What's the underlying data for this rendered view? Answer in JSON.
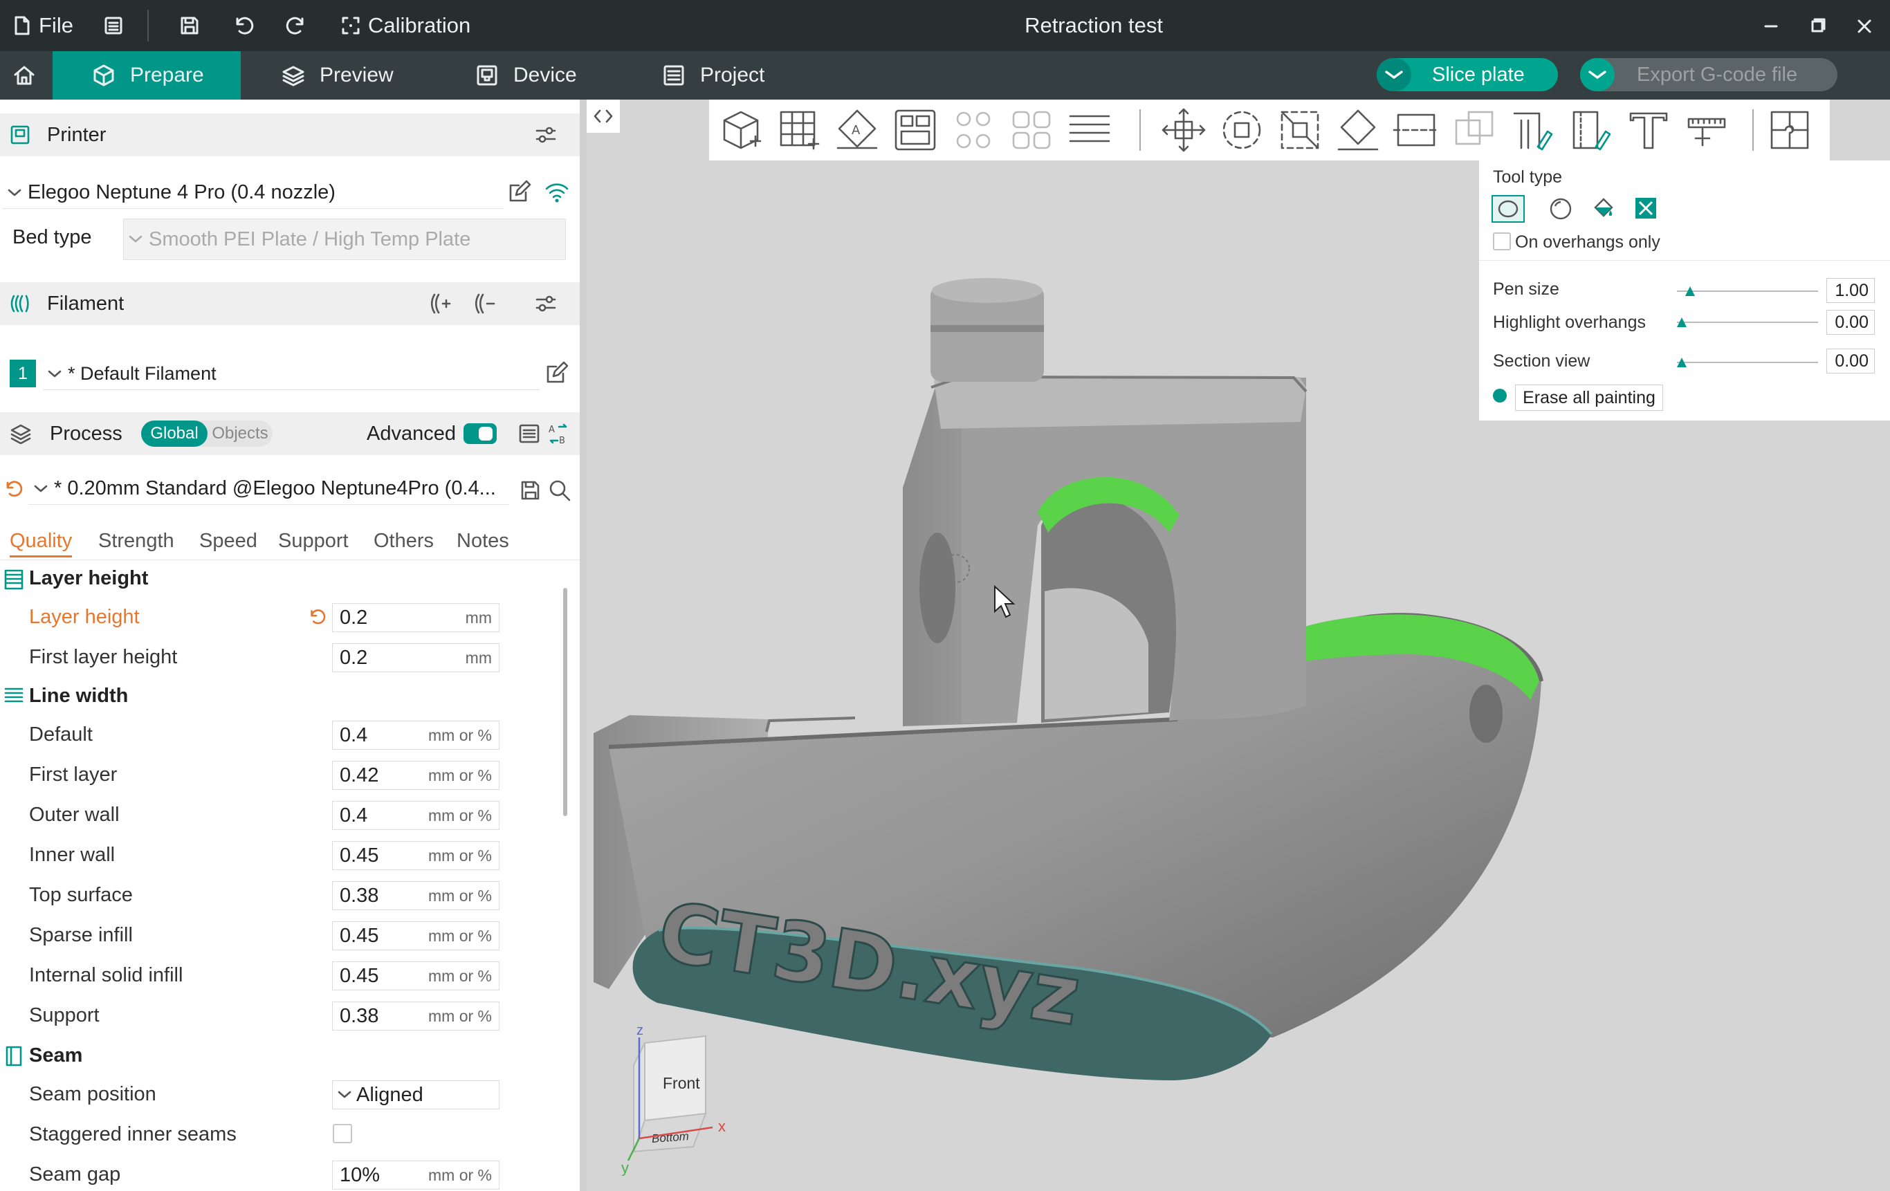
{
  "window": {
    "title": "Retraction test",
    "menu_file": "File",
    "menu_calibration": "Calibration"
  },
  "tabs": [
    {
      "label": "Prepare",
      "active": true
    },
    {
      "label": "Preview",
      "active": false
    },
    {
      "label": "Device",
      "active": false
    },
    {
      "label": "Project",
      "active": false
    }
  ],
  "actions": {
    "slice": "Slice plate",
    "export": "Export G-code file"
  },
  "printer": {
    "section_title": "Printer",
    "name": "Elegoo Neptune 4 Pro (0.4 nozzle)",
    "bed_type_label": "Bed type",
    "bed_type_value": "Smooth PEI Plate / High Temp Plate"
  },
  "filament": {
    "section_title": "Filament",
    "slot": "1",
    "name": "* Default Filament"
  },
  "process": {
    "section_title": "Process",
    "toggle_global": "Global",
    "toggle_objects": "Objects",
    "advanced_label": "Advanced",
    "advanced_on": true,
    "profile": "* 0.20mm Standard @Elegoo Neptune4Pro (0.4...",
    "subtabs": [
      "Quality",
      "Strength",
      "Speed",
      "Support",
      "Others",
      "Notes"
    ],
    "active_subtab": "Quality"
  },
  "quality": {
    "layer_height_group": "Layer height",
    "layer_height": {
      "label": "Layer height",
      "value": "0.2",
      "unit": "mm",
      "modified": true
    },
    "first_layer_height": {
      "label": "First layer height",
      "value": "0.2",
      "unit": "mm"
    },
    "line_width_group": "Line width",
    "line_widths": [
      {
        "label": "Default",
        "value": "0.4",
        "unit": "mm or %"
      },
      {
        "label": "First layer",
        "value": "0.42",
        "unit": "mm or %"
      },
      {
        "label": "Outer wall",
        "value": "0.4",
        "unit": "mm or %"
      },
      {
        "label": "Inner wall",
        "value": "0.45",
        "unit": "mm or %"
      },
      {
        "label": "Top surface",
        "value": "0.38",
        "unit": "mm or %"
      },
      {
        "label": "Sparse infill",
        "value": "0.45",
        "unit": "mm or %"
      },
      {
        "label": "Internal solid infill",
        "value": "0.45",
        "unit": "mm or %"
      },
      {
        "label": "Support",
        "value": "0.38",
        "unit": "mm or %"
      }
    ],
    "seam_group": "Seam",
    "seam_position": {
      "label": "Seam position",
      "value": "Aligned"
    },
    "staggered_inner_seams": {
      "label": "Staggered inner seams",
      "checked": false
    },
    "seam_gap": {
      "label": "Seam gap",
      "value": "10%",
      "unit": "mm or %"
    }
  },
  "paint_panel": {
    "tool_type_label": "Tool type",
    "overhangs_only_label": "On overhangs only",
    "pen_size": {
      "label": "Pen size",
      "value": "1.00",
      "fraction": 0.06
    },
    "highlight_overhangs": {
      "label": "Highlight overhangs",
      "value": "0.00",
      "fraction": 0.0
    },
    "section_view": {
      "label": "Section view",
      "value": "0.00",
      "fraction": 0.0
    },
    "erase_button": "Erase all painting"
  },
  "model": {
    "embossed_text": "CT3D.xyz"
  },
  "view_cube": {
    "front": "Front",
    "bottom": "Bottom",
    "axis_x": "x",
    "axis_y": "y",
    "axis_z": "z"
  },
  "colors": {
    "accent": "#009688",
    "modified": "#e8772e",
    "title_bar": "#262e30",
    "tab_bar": "#353e40",
    "paint_green": "#5ad24a",
    "model_base": "#3f6766"
  }
}
